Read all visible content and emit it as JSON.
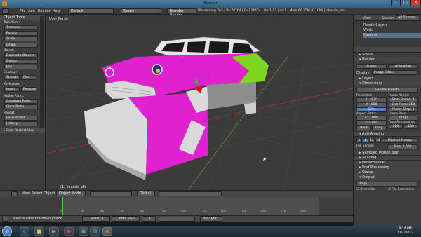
{
  "window": {
    "title": "Blender",
    "minimize": "–",
    "maximize": "□",
    "close": "✕"
  },
  "menu": {
    "file": "File",
    "add": "Add",
    "render": "Render",
    "help": "Help"
  },
  "screen_select": "Default",
  "scene_select": "Scene",
  "engine_select": "Blender Render",
  "stats": "Blender.org 263 | Ve:78764 | Fa:134424 | Ob:1-17 | La:1 | Mem:66.75M (0.10M) | chassis_vfo",
  "tools": {
    "header": "Object Tools",
    "transform_label": "Transform:",
    "translate": "Translate",
    "rotate": "Rotate",
    "scale": "Scale",
    "origin": "Origin",
    "object_label": "Object:",
    "duplicate": "Duplicate Objects",
    "delete": "Delete",
    "join": "Join",
    "shading_label": "Shading:",
    "smooth": "Smooth",
    "flat": "Flat",
    "keyframes_label": "Keyframes:",
    "insert": "Insert",
    "remove": "Remove",
    "motion_label": "Motion Paths:",
    "calculate": "Calculate Paths",
    "clear": "Clear Paths",
    "repeat_label": "Repeat:",
    "repeat_last": "Repeat Last",
    "history": "History...",
    "clear_restrict": "Clear Restrict View"
  },
  "viewport": {
    "label": "User Persp",
    "object_label": "(1) chassis_vfo"
  },
  "vp_header": {
    "view": "View",
    "select": "Select",
    "object": "Object",
    "mode": "Object Mode",
    "global": "Global"
  },
  "tl_header": {
    "view": "View",
    "marker": "Marker",
    "frame": "Frame",
    "playback": "Playback",
    "start": "Start: 1",
    "end": "End: 250",
    "current": "1",
    "sync": "No Sync"
  },
  "timeline_ticks": [
    "0",
    "20",
    "40",
    "60",
    "80",
    "100",
    "120",
    "140",
    "160",
    "180",
    "200",
    "220",
    "240"
  ],
  "outliner": {
    "view": "View",
    "search": "Search",
    "all_scenes": "All Scenes",
    "items": [
      "RenderLayers",
      "World",
      "Camera"
    ]
  },
  "props": {
    "scene": "Scene",
    "render_panel": "Render",
    "image_btn": "Image",
    "animation_btn": "Animation",
    "display_label": "Display:",
    "display_val": "Image Editor",
    "layers_panel": "Layers",
    "dimensions_panel": "Dimensions",
    "presets": "Render Presets",
    "resolution_label": "Resolution:",
    "frame_range_label": "Frame Range:",
    "res_x": "X: 1920",
    "res_y": "Y: 1080",
    "res_pct": "50%",
    "start_frame": "Start Frame: 1",
    "end_frame": "End Fram: 250",
    "frame_step": "Frame Step: 1",
    "aspect_label": "Aspect Ratio:",
    "frame_rate_label": "Frame Rate:",
    "asp_x": "X: 1.000",
    "asp_y": "Y: 1.000",
    "fps": "24 fps",
    "time_remap_label": "Time Remapping:",
    "border": "Bord",
    "crop": "Crop",
    "old": "100",
    "new": "100",
    "aa_panel": "Anti-Aliasing",
    "aa_samples": [
      "5",
      "8",
      "11",
      "16"
    ],
    "aa_filter": "Mitchell-Netrav",
    "full_sample": "Full Sample",
    "size": "Size: 1.000",
    "sampled_motion": "Sampled Motion Blur",
    "shading": "Shading",
    "performance": "Performance",
    "post": "Post Processing",
    "stamp": "Stamp",
    "output": "Output",
    "output_path": "/tmp\\",
    "overwrite": "Overwrite",
    "file_ext": "File Extensions"
  },
  "clock": {
    "time": "9:14 PM",
    "date": "11/1/2012"
  },
  "colors": {
    "magenta": "#e021d0",
    "lime": "#7fd61e",
    "white_body": "#d9d9d9",
    "accent": "#4e82c4"
  }
}
